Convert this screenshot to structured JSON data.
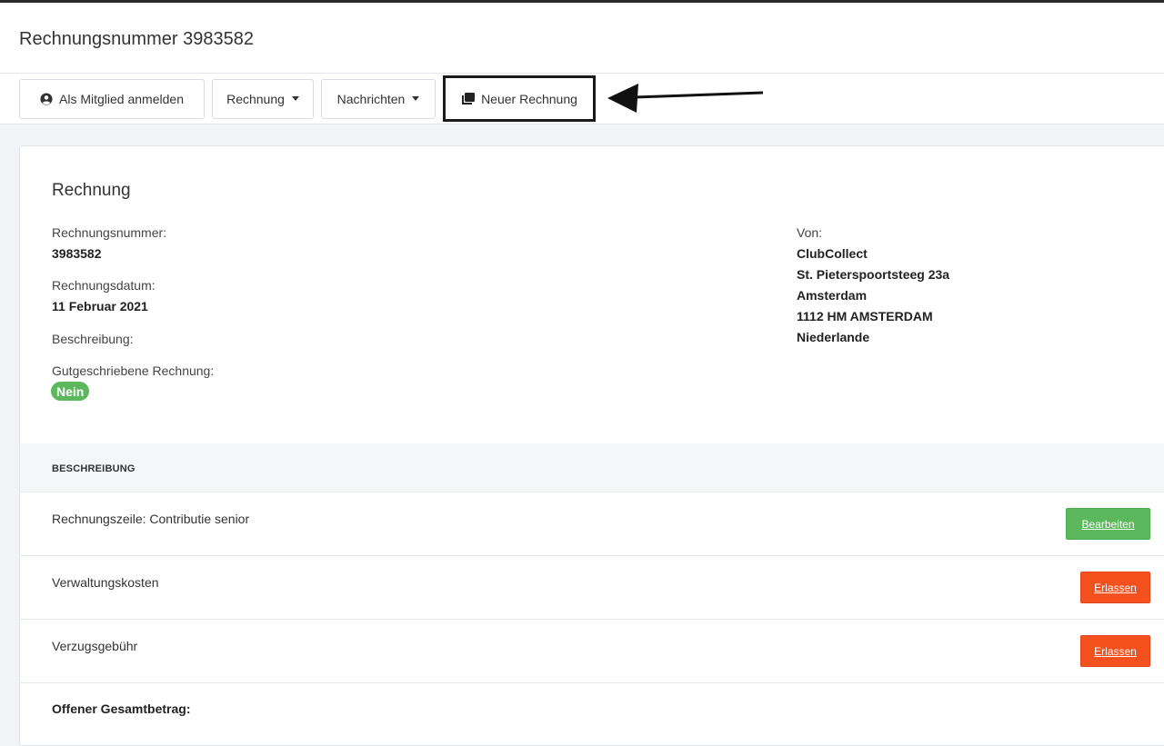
{
  "header": {
    "title": "Rechnungsnummer 3983582"
  },
  "toolbar": {
    "member_login_label": "Als Mitglied anmelden",
    "invoice_label": "Rechnung",
    "messages_label": "Nachrichten",
    "new_invoice_label": "Neuer Rechnung"
  },
  "invoice": {
    "section_title": "Rechnung",
    "number_label": "Rechnungsnummer:",
    "number_value": "3983582",
    "date_label": "Rechnungsdatum:",
    "date_value": "11 Februar 2021",
    "description_label": "Beschreibung:",
    "credited_label": "Gutgeschriebene Rechnung:",
    "credited_value": "Nein",
    "from": {
      "label": "Von:",
      "lines": [
        "ClubCollect",
        "St. Pieterspoortsteeg 23a",
        "Amsterdam",
        "1112 HM AMSTERDAM",
        "Niederlande"
      ]
    }
  },
  "table": {
    "header": "BESCHREIBUNG",
    "rows": [
      {
        "description": "Rechnungszeile: Contributie senior",
        "action": "Bearbeiten"
      },
      {
        "description": "Verwaltungskosten",
        "action": "Erlassen"
      },
      {
        "description": "Verzugsgebühr",
        "action": "Erlassen"
      }
    ],
    "total_label": "Offener Gesamtbetrag:"
  },
  "colors": {
    "success": "#5cb85c",
    "danger": "#f4511e",
    "page_bg": "#f2f3f7"
  },
  "icons": {
    "member_login": "user-circle-icon",
    "new_invoice": "copy-icon",
    "annotation": "arrow-left-icon"
  }
}
